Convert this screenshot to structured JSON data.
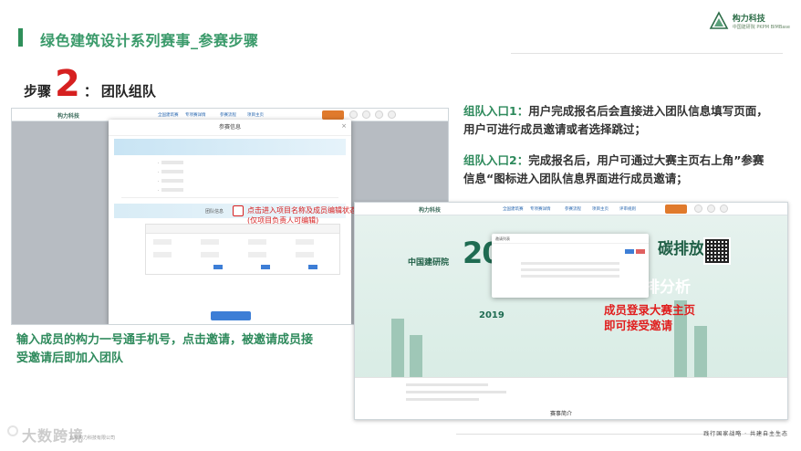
{
  "header": {
    "title": "绿色建筑设计系列赛事_参赛步骤",
    "brand_name": "构力科技",
    "brand_sub": "中国建研院 PKPM BIMBase"
  },
  "step": {
    "label": "步骤",
    "number": "2",
    "colon": "：",
    "description": "团队组队"
  },
  "entries": [
    {
      "label": "组队入口1：",
      "text": "用户完成报名后会直接进入团队信息填写页面，用户可进行成员邀请或者选择跳过；"
    },
    {
      "label": "组队入口2：",
      "text": "完成报名后，用户可通过大赛主页右上角”参赛信息“图标进入团队信息界面进行成员邀请；"
    }
  ],
  "screenshot_left": {
    "logo": "构力科技",
    "nav": [
      "全国建筑赛",
      "专项赛详情",
      "参赛流程",
      "项目主页"
    ],
    "modal_title": "参赛信息",
    "team_label": "团队信息",
    "annotation_line1": "点击进入项目名称及成员编辑状态",
    "annotation_line2": "(仅项目负责人可编辑)"
  },
  "screenshot_right": {
    "logo": "构力科技",
    "nav": [
      "全国建筑赛",
      "专项赛详情",
      "参赛流程",
      "项目主页",
      "评审规则"
    ],
    "big_year": "202",
    "small_year": "2019",
    "banner_cn": "碳排放",
    "banner_cn2": "碳排分析",
    "logo_cn": "中国建研院",
    "footer_title": "赛事简介",
    "modal_title": "邀请列表",
    "annotation": "成员登录大赛主页即可接受邀请"
  },
  "bottom_text": "输入成员的构力一号通手机号，点击邀请，被邀请成员接受邀请后即加入团队",
  "footer": {
    "slogan": "践行国家战略 · 共建自主生态",
    "watermark": "大数跨境",
    "left": "北京构力科技有限公司"
  },
  "colors": {
    "accent_green": "#2e8a5c",
    "red": "#d62020"
  }
}
